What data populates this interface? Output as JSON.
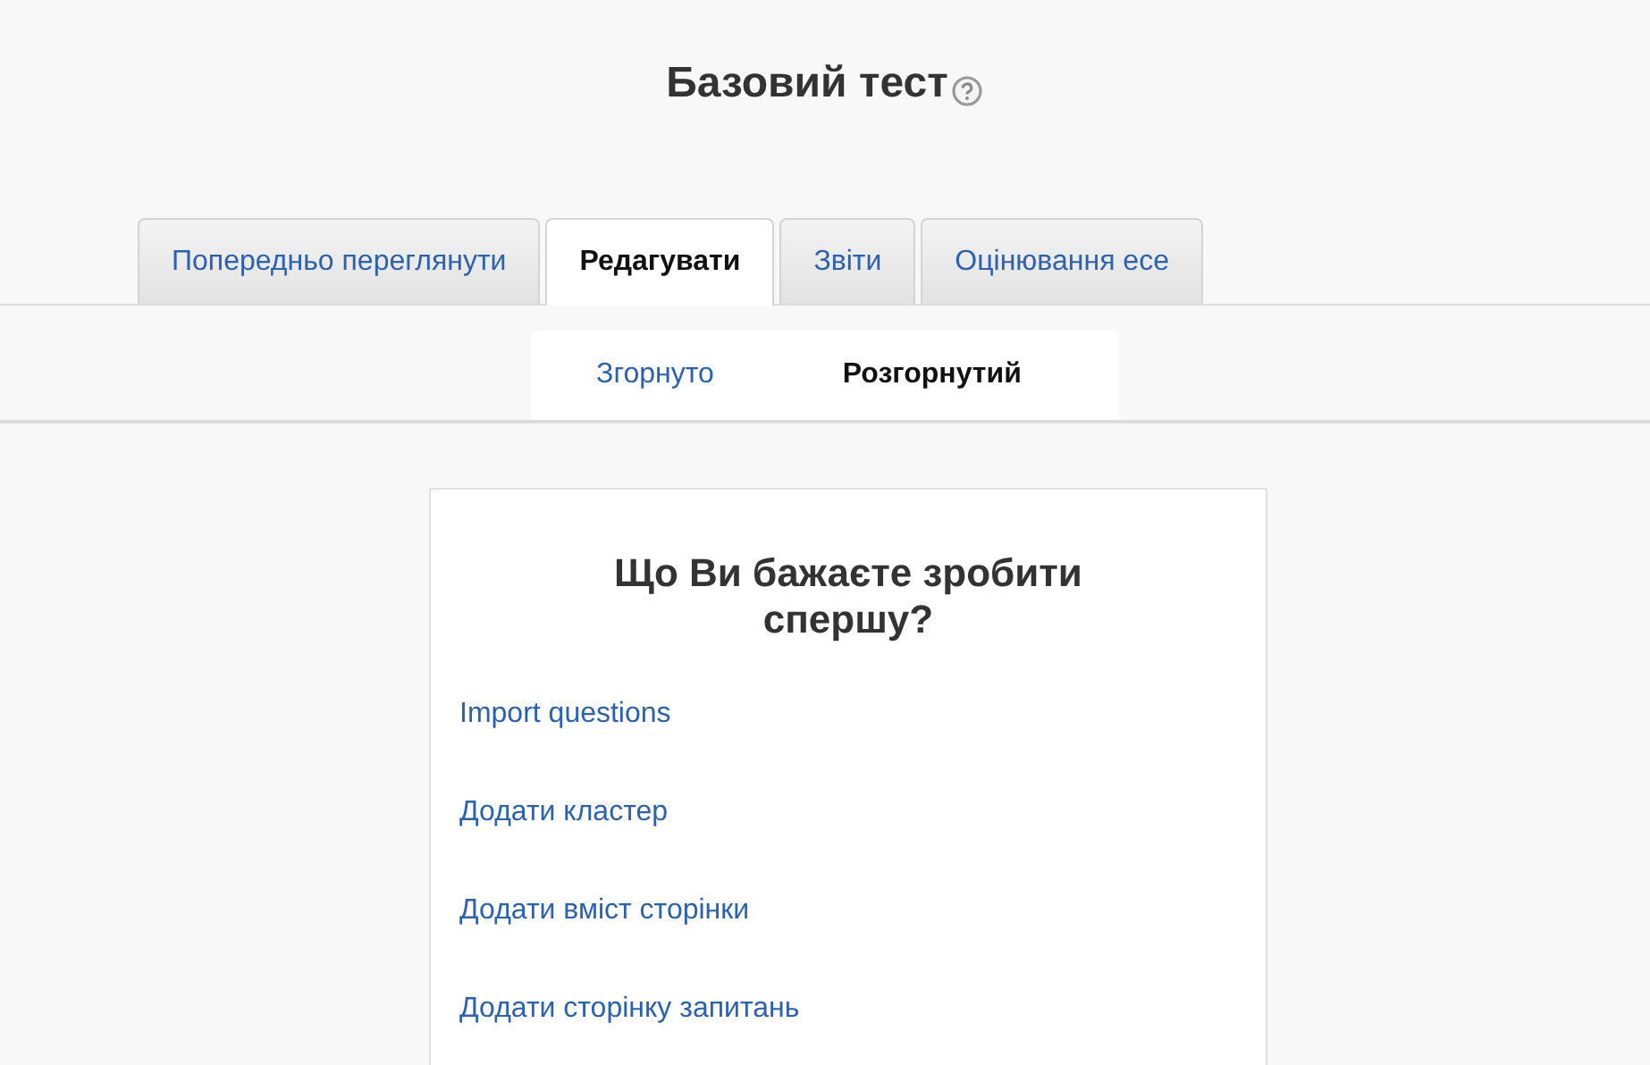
{
  "page_title": "Базовий тест",
  "tabs": [
    {
      "label": "Попередньо переглянути",
      "selected": false
    },
    {
      "label": "Редагувати",
      "selected": true
    },
    {
      "label": "Звіти",
      "selected": false
    },
    {
      "label": "Оцінювання есе",
      "selected": false
    }
  ],
  "subtabs": [
    {
      "label": "Згорнуто",
      "selected": false
    },
    {
      "label": "Розгорнутий",
      "selected": true
    }
  ],
  "card": {
    "heading": "Що Ви бажаєте зробити спершу?",
    "links": [
      "Import questions",
      "Додати кластер",
      "Додати вміст сторінки",
      "Додати сторінку запитань"
    ]
  }
}
